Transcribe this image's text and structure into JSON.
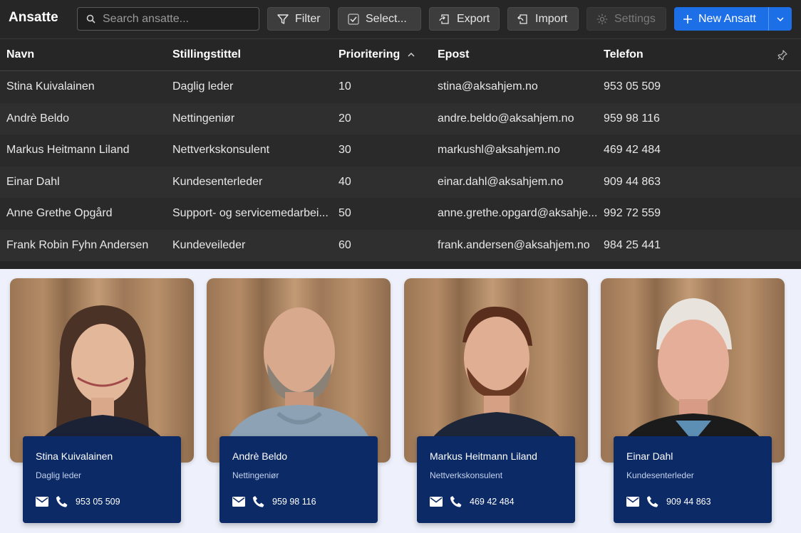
{
  "app": {
    "title": "Ansatte"
  },
  "search": {
    "placeholder": "Search ansatte..."
  },
  "toolbar": {
    "filter": "Filter",
    "select": "Select...",
    "export": "Export",
    "import": "Import",
    "settings": "Settings",
    "new": "New Ansatt"
  },
  "table": {
    "columns": [
      "Navn",
      "Stillingstittel",
      "Prioritering",
      "Epost",
      "Telefon"
    ],
    "sort": {
      "column": "Prioritering",
      "direction": "ascending"
    },
    "rows": [
      [
        "Stina Kuivalainen",
        "Daglig leder",
        "10",
        "stina@aksahjem.no",
        "953 05 509"
      ],
      [
        "Andrè Beldo",
        "Nettingeniør",
        "20",
        "andre.beldo@aksahjem.no",
        "959 98 116"
      ],
      [
        "Markus Heitmann Liland",
        "Nettverkskonsulent",
        "30",
        "markushl@aksahjem.no",
        "469 42 484"
      ],
      [
        "Einar Dahl",
        "Kundesenterleder",
        "40",
        "einar.dahl@aksahjem.no",
        "909 44 863"
      ],
      [
        "Anne Grethe Opgård",
        "Support- og servicemedarbei...",
        "50",
        "anne.grethe.opgard@aksahje...",
        "992 72 559"
      ],
      [
        "Frank Robin Fyhn Andersen",
        "Kundeveileder",
        "60",
        "frank.andersen@aksahjem.no",
        "984 25 441"
      ]
    ]
  },
  "cards": [
    {
      "name": "Stina Kuivalainen",
      "role": "Daglig leder",
      "phone": "953 05 509"
    },
    {
      "name": "Andrè Beldo",
      "role": "Nettingeniør",
      "phone": "959 98 116"
    },
    {
      "name": "Markus Heitmann Liland",
      "role": "Nettverkskonsulent",
      "phone": "469 42 484"
    },
    {
      "name": "Einar Dahl",
      "role": "Kundesenterleder",
      "phone": "909 44 863"
    }
  ],
  "colors": {
    "primary": "#1d6fe8",
    "card_bg": "#0b2a66",
    "app_bg": "#262626",
    "page_bg": "#eef1fb"
  }
}
